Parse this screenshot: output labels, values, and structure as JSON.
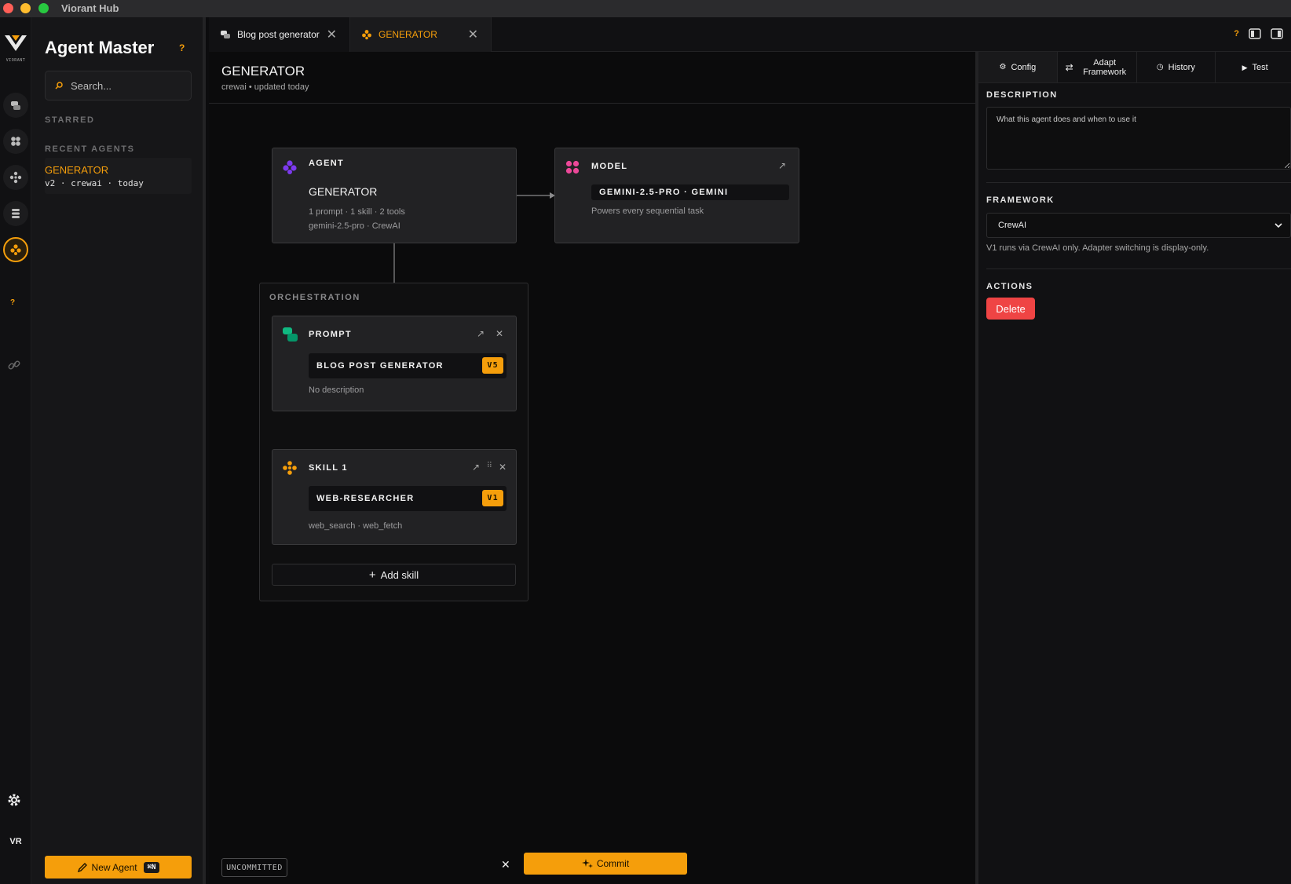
{
  "window": {
    "title": "Viorant Hub"
  },
  "rail": {
    "logo_text": "VIORANT",
    "avatar_initials": "VR"
  },
  "sidebar": {
    "title": "Agent Master",
    "help": "?",
    "search_placeholder": "Search...",
    "starred_label": "STARRED",
    "recent_label": "RECENT AGENTS",
    "recent": [
      {
        "name": "GENERATOR",
        "meta": "v2 · crewai · today"
      }
    ],
    "new_agent_label": "New Agent",
    "new_agent_shortcut": "⌘N"
  },
  "tabs": [
    {
      "label": "Blog post generator",
      "active": false
    },
    {
      "label": "GENERATOR",
      "active": true
    }
  ],
  "tabs_help": "?",
  "main": {
    "title": "GENERATOR",
    "subtitle": "crewai • updated today",
    "agent": {
      "header": "AGENT",
      "name": "GENERATOR",
      "line1": "1 prompt · 1 skill · 2 tools",
      "line2": "gemini-2.5-pro · CrewAI"
    },
    "model": {
      "header": "MODEL",
      "value": "GEMINI-2.5-PRO · GEMINI",
      "desc": "Powers every sequential task"
    },
    "orchestration_label": "ORCHESTRATION",
    "prompt": {
      "header": "PROMPT",
      "name": "BLOG POST GENERATOR",
      "version": "V5",
      "desc": "No description"
    },
    "skill": {
      "header": "SKILL 1",
      "name": "WEB-RESEARCHER",
      "version": "V1",
      "desc": "web_search · web_fetch"
    },
    "add_skill_label": "Add skill",
    "uncommitted_label": "UNCOMMITTED",
    "commit_label": "Commit"
  },
  "right": {
    "tabs": [
      {
        "label": "Config",
        "active": true
      },
      {
        "label": "Adapt Framework",
        "active": false
      },
      {
        "label": "History",
        "active": false
      },
      {
        "label": "Test",
        "active": false
      }
    ],
    "description_label": "DESCRIPTION",
    "description_placeholder": "What this agent does and when to use it",
    "framework_label": "FRAMEWORK",
    "framework_value": "CrewAI",
    "framework_note": "V1 runs via CrewAI only. Adapter switching is display-only.",
    "actions_label": "ACTIONS",
    "delete_label": "Delete"
  },
  "colors": {
    "accent": "#f59e0b",
    "danger": "#ef4444",
    "background": "#0b0b0c"
  }
}
